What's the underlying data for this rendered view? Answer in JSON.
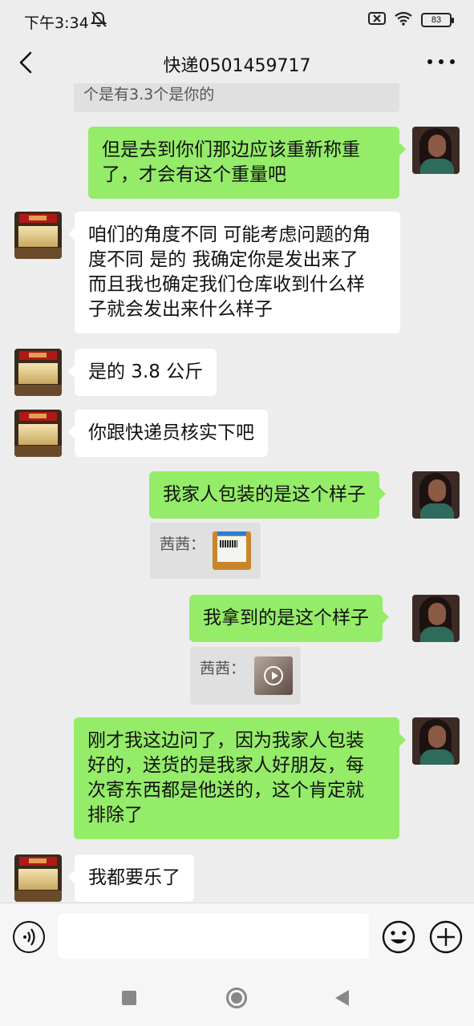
{
  "status_bar": {
    "time": "下午3:34",
    "battery": "83",
    "icons": [
      "mute-icon",
      "sim-off-icon",
      "wifi-icon",
      "battery-icon"
    ]
  },
  "header": {
    "title": "快递0501459717",
    "back_icon": "chevron-left-icon",
    "more_icon": "more-dots-icon"
  },
  "messages": [
    {
      "side": "left",
      "type": "quote",
      "text": "个是有3.3个是你的"
    },
    {
      "side": "right",
      "type": "text",
      "text": "但是去到你们那边应该重新称重\n了，才会有这个重量吧"
    },
    {
      "side": "left",
      "type": "text",
      "text": "咱们的角度不同 可能考虑问题的角\n度不同 是的 我确定你是发出来了\n而且我也确定我们仓库收到什么样\n子就会发出来什么样子"
    },
    {
      "side": "left",
      "type": "text",
      "text": "是的 3.8 公斤"
    },
    {
      "side": "left",
      "type": "text",
      "text": "你跟快递员核实下吧"
    },
    {
      "side": "right",
      "type": "text",
      "text": "我家人包装的是这个样子"
    },
    {
      "side": "right",
      "type": "quote",
      "text": "茜茜：",
      "attachment": "image"
    },
    {
      "side": "right",
      "type": "text",
      "text": "我拿到的是这个样子"
    },
    {
      "side": "right",
      "type": "quote",
      "text": "茜茜：",
      "attachment": "video"
    },
    {
      "side": "right",
      "type": "text",
      "text": "刚才我这边问了，因为我家人包装\n好的，送货的是我家人好朋友，每\n次寄东西都是他送的，这个肯定就\n排除了"
    },
    {
      "side": "left",
      "type": "text",
      "text": "我都要乐了"
    }
  ],
  "input": {
    "placeholder": "",
    "voice_icon": "voice-icon",
    "emoji_icon": "emoji-icon",
    "plus_icon": "plus-icon"
  },
  "colors": {
    "background": "#ededed",
    "sent_bubble": "#95ec69",
    "received_bubble": "#ffffff"
  }
}
